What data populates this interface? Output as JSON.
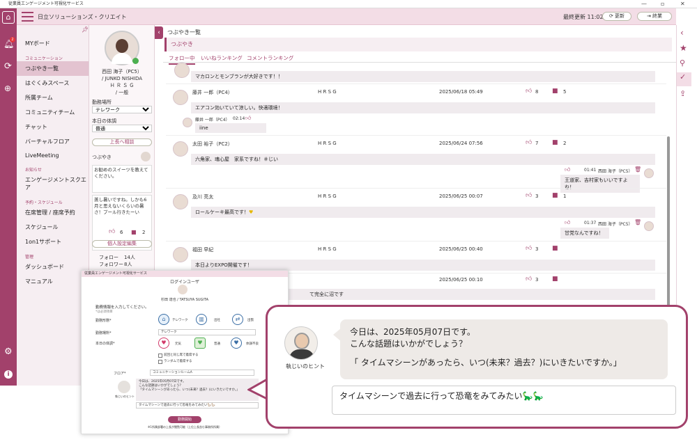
{
  "window": {
    "title": "従業員エンゲージメント可視化サービス",
    "controls": [
      "—",
      "▫",
      "✕"
    ]
  },
  "topbar": {
    "company": "日立ソリューションズ・クリエイト",
    "last_updated": "最終更新 11:02",
    "refresh": "更新",
    "end": "終業"
  },
  "left_rail": {
    "badge": "2"
  },
  "nav": {
    "myboard": "MYボード",
    "comm_header": "コミュニケーション",
    "comm_items": [
      "つぶやき一覧",
      "はぐくみスペース",
      "所属チーム",
      "コミュニティチーム",
      "チャット",
      "バーチャルフロア",
      "LiveMeeting"
    ],
    "notice_header": "お知らせ",
    "notice_items": [
      "エンゲージメントスクエア"
    ],
    "sched_header": "予約・スケジュール",
    "sched_items": [
      "在席管理 / 座席予約",
      "スケジュール",
      "1on1サポート"
    ],
    "admin_header": "管理",
    "admin_items": [
      "ダッシュボード",
      "マニュアル"
    ]
  },
  "profile": {
    "name_jp": "西田 海子（PC5）",
    "name_en": "/ JUNKO NISHIDA",
    "dept": "Ｈ Ｒ Ｓ Ｇ",
    "role": "/ 一般",
    "work_place_label": "勤務場所",
    "work_place": "テレワーク",
    "condition_label": "本日の体調",
    "condition": "普通",
    "consult_button": "上長へ相談",
    "tweet_label": "つぶやき",
    "tweet1": "お勧めのスイーツを教えてください。",
    "tweet2": "蒸し暑いですね。しかも6月と思えないくらいの暑さ！プール行きたーい",
    "likes": "6",
    "comments": "2",
    "settings_button": "個人設定編集",
    "follow_label": "フォロー",
    "follow_count": "14人",
    "follower_label": "フォロワー",
    "follower_count": "8人"
  },
  "feed": {
    "title": "つぶやき一覧",
    "subtitle": "つぶやき",
    "tabs": [
      "フォロー中",
      "いいねランキング",
      "コメントランキング"
    ],
    "post0": {
      "text": "マカロンとモンブランが大好きです！！"
    },
    "post1": {
      "author": "藤井 一郎（PC4）",
      "dept": "H R S G",
      "date": "2025/06/18 05:49",
      "text": "エアコン効いていて涼しい。快適環境！",
      "likes": "8",
      "comments": "5",
      "reply": {
        "author": "藤井 一郎（PC4）",
        "time": "02:14",
        "text": "iine"
      }
    },
    "post2": {
      "author": "太田 裕子（PC2）",
      "dept": "H R S G",
      "date": "2025/06/24 07:56",
      "text": "六角家、魂心屋　家系ですね！＃じい",
      "likes": "7",
      "comments": "2",
      "reply": {
        "time": "01:41",
        "author": "西田 海子（PC5）",
        "text": "王道家、吉村家もいいですよね！"
      }
    },
    "post3": {
      "author": "及川 亮太",
      "dept": "H R S G",
      "date": "2025/06/25 00:07",
      "text": "ロールケーキ最高です！",
      "likes": "3",
      "comments": "1",
      "reply": {
        "time": "01:37",
        "author": "西田 海子（PC5）",
        "text": "甘党なんですね！"
      }
    },
    "post4": {
      "author": "福田 早紀",
      "dept": "H R S G",
      "date": "2025/06/25 00:40",
      "text": "本日よりEXPO開催です！",
      "likes": "3"
    },
    "post5": {
      "date": "2025/06/25 00:10",
      "text": "て完全に沼です",
      "likes": "3"
    }
  },
  "popup": {
    "title": "従業員エンゲージメント可視化サービス",
    "login_user": "ログインユーザ",
    "user_name": "杉田 達也 / TATSUYA SUGITA",
    "prompt": "勤務情報を入力してください。",
    "prompt_note": "*は必須項目",
    "work_form_label": "勤務形態*",
    "work_forms": [
      "テレワーク",
      "出社",
      "出張"
    ],
    "work_place_label": "勤務場所*",
    "work_place": "テレワーク",
    "condition_label": "本日の体調*",
    "conditions": [
      "元気",
      "普通",
      "体調不良"
    ],
    "check1": "前回と同じ席で着席する",
    "check2": "ランダムで着席する",
    "floor_label": "フロア*",
    "floor": "コミュニケーションルームA",
    "hint_line1": "今日は、2025年05月07日です。",
    "hint_line2": "こんな話題はいかがでしょう？",
    "hint_line3": "「タイムマシーンがあったら、いつ(未来？過去？)にいきたいですか。」",
    "hint_caption": "執じいのヒント",
    "answer": "タイムマシーンで過去に行って恐竜をみてみたい",
    "start_button": "勤務開始",
    "footer": "※1所属部署の上長が閲覧可能（上位上長含む事務所所属）"
  },
  "callout": {
    "line1": "今日は、2025年05月07日です。",
    "line2": "こんな話題はいかがでしょう？",
    "line3": "「 タイムマシーンがあったら、いつ(未来？過去？)にいきたいですか。」",
    "caption": "執じいのヒント",
    "answer": "タイムマシーンで過去に行って恐竜をみてみたい",
    "answer_emoji": "🦕🦕"
  }
}
